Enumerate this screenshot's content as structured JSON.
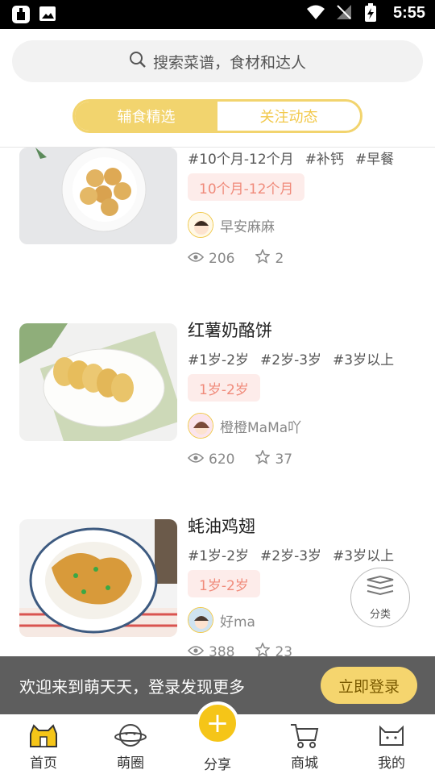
{
  "status_bar": {
    "time": "5:55"
  },
  "search": {
    "placeholder": "搜索菜谱，食材和达人"
  },
  "tabs": [
    {
      "label": "辅食精选",
      "active": true
    },
    {
      "label": "关注动态",
      "active": false
    }
  ],
  "recipes": [
    {
      "title": "",
      "tags": [
        "#10个月-12个月",
        "#补钙",
        "#早餐"
      ],
      "age": "10个月-12个月",
      "author": "早安麻麻",
      "views": "206",
      "stars": "2"
    },
    {
      "title": "红薯奶酪饼",
      "tags": [
        "#1岁-2岁",
        "#2岁-3岁",
        "#3岁以上"
      ],
      "age": "1岁-2岁",
      "author": "橙橙MaMa吖",
      "views": "620",
      "stars": "37"
    },
    {
      "title": "蚝油鸡翅",
      "tags": [
        "#1岁-2岁",
        "#2岁-3岁",
        "#3岁以上"
      ],
      "age": "1岁-2岁",
      "author": "好ma",
      "views": "388",
      "stars": "23"
    }
  ],
  "fab": {
    "label": "分类"
  },
  "login_bar": {
    "message": "欢迎来到萌天天，登录发现更多",
    "button": "立即登录"
  },
  "nav": [
    {
      "label": "首页",
      "icon": "home-cat-icon",
      "active": true
    },
    {
      "label": "萌圈",
      "icon": "planet-cat-icon"
    },
    {
      "label": "分享",
      "icon": "plus-icon"
    },
    {
      "label": "商城",
      "icon": "cart-icon"
    },
    {
      "label": "我的",
      "icon": "cat-face-icon"
    }
  ],
  "colors": {
    "accent": "#f2d46e",
    "tag_bg": "#fdecea",
    "tag_text": "#f08a7a"
  }
}
